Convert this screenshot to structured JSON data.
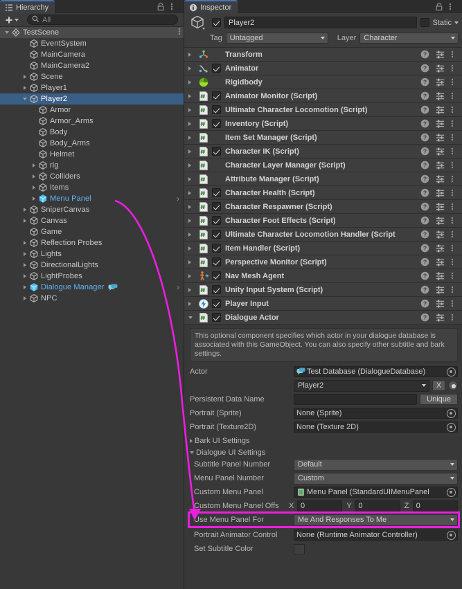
{
  "hierarchy": {
    "tab_label": "Hierarchy",
    "tab_icon": "hierarchy-icon",
    "toolbar": {
      "add_label": "+",
      "search_placeholder": "All",
      "search_value": ""
    },
    "items": [
      {
        "label": "TestScene",
        "depth": 0,
        "twisty": "down",
        "icon": "scene-icon",
        "type": "scene",
        "selected": false,
        "kebab": true
      },
      {
        "label": "EventSystem",
        "depth": 2,
        "twisty": "none",
        "icon": "gameobject-icon",
        "type": "go",
        "selected": false
      },
      {
        "label": "MainCamera",
        "depth": 2,
        "twisty": "none",
        "icon": "gameobject-icon",
        "type": "go",
        "selected": false
      },
      {
        "label": "MainCamera2",
        "depth": 2,
        "twisty": "none",
        "icon": "gameobject-icon",
        "type": "go",
        "selected": false
      },
      {
        "label": "Scene",
        "depth": 2,
        "twisty": "right",
        "icon": "gameobject-icon",
        "type": "go",
        "selected": false
      },
      {
        "label": "Player1",
        "depth": 2,
        "twisty": "right",
        "icon": "gameobject-icon",
        "type": "go",
        "selected": false
      },
      {
        "label": "Player2",
        "depth": 2,
        "twisty": "down",
        "icon": "gameobject-icon",
        "type": "go",
        "selected": true
      },
      {
        "label": "Armor",
        "depth": 3,
        "twisty": "none",
        "icon": "gameobject-icon",
        "type": "go",
        "selected": false
      },
      {
        "label": "Armor_Arms",
        "depth": 3,
        "twisty": "none",
        "icon": "gameobject-icon",
        "type": "go",
        "selected": false
      },
      {
        "label": "Body",
        "depth": 3,
        "twisty": "none",
        "icon": "gameobject-icon",
        "type": "go",
        "selected": false
      },
      {
        "label": "Body_Arms",
        "depth": 3,
        "twisty": "none",
        "icon": "gameobject-icon",
        "type": "go",
        "selected": false
      },
      {
        "label": "Helmet",
        "depth": 3,
        "twisty": "none",
        "icon": "gameobject-icon",
        "type": "go",
        "selected": false
      },
      {
        "label": "rig",
        "depth": 3,
        "twisty": "right",
        "icon": "gameobject-icon",
        "type": "go",
        "selected": false
      },
      {
        "label": "Colliders",
        "depth": 3,
        "twisty": "right",
        "icon": "gameobject-icon",
        "type": "go",
        "selected": false
      },
      {
        "label": "Items",
        "depth": 3,
        "twisty": "right",
        "icon": "gameobject-icon",
        "type": "go",
        "selected": false
      },
      {
        "label": "Menu Panel",
        "depth": 3,
        "twisty": "right",
        "icon": "prefab-icon",
        "type": "prefab",
        "selected": false,
        "chevron": true
      },
      {
        "label": "SniperCanvas",
        "depth": 2,
        "twisty": "right",
        "icon": "gameobject-icon",
        "type": "go",
        "selected": false
      },
      {
        "label": "Canvas",
        "depth": 2,
        "twisty": "right",
        "icon": "gameobject-icon",
        "type": "go",
        "selected": false
      },
      {
        "label": "Game",
        "depth": 2,
        "twisty": "none",
        "icon": "gameobject-icon",
        "type": "go",
        "selected": false
      },
      {
        "label": "Reflection Probes",
        "depth": 2,
        "twisty": "right",
        "icon": "gameobject-icon",
        "type": "go",
        "selected": false
      },
      {
        "label": "Lights",
        "depth": 2,
        "twisty": "right",
        "icon": "gameobject-icon",
        "type": "go",
        "selected": false
      },
      {
        "label": "DirectionalLights",
        "depth": 2,
        "twisty": "right",
        "icon": "gameobject-icon",
        "type": "go",
        "selected": false
      },
      {
        "label": "LightProbes",
        "depth": 2,
        "twisty": "right",
        "icon": "gameobject-icon",
        "type": "go",
        "selected": false
      },
      {
        "label": "Dialogue Manager",
        "depth": 2,
        "twisty": "right",
        "icon": "prefab-icon",
        "type": "prefab",
        "selected": false,
        "chevron": true,
        "badge": "dialogue-badge-icon"
      },
      {
        "label": "NPC",
        "depth": 2,
        "twisty": "right",
        "icon": "gameobject-icon",
        "type": "go",
        "selected": false
      }
    ]
  },
  "inspector": {
    "tab_label": "Inspector",
    "tab_icon": "info-icon",
    "header": {
      "enabled": true,
      "object_name": "Player2",
      "static_label": "Static",
      "static_checked": false,
      "tag_label": "Tag",
      "tag_value": "Untagged",
      "layer_label": "Layer",
      "layer_value": "Character"
    },
    "components": [
      {
        "name": "Transform",
        "icon": "transform-icon",
        "has_toggle": false,
        "checked": false,
        "expanded": false
      },
      {
        "name": "Animator",
        "icon": "animator-icon",
        "has_toggle": true,
        "checked": true,
        "expanded": false
      },
      {
        "name": "Rigidbody",
        "icon": "rigidbody-icon",
        "has_toggle": false,
        "checked": false,
        "expanded": false
      },
      {
        "name": "Animator Monitor (Script)",
        "icon": "script-icon",
        "has_toggle": true,
        "checked": true,
        "expanded": false
      },
      {
        "name": "Ultimate Character Locomotion (Script)",
        "icon": "script-icon",
        "has_toggle": true,
        "checked": true,
        "expanded": false
      },
      {
        "name": "Inventory (Script)",
        "icon": "script-icon",
        "has_toggle": true,
        "checked": true,
        "expanded": false
      },
      {
        "name": "Item Set Manager (Script)",
        "icon": "script-icon",
        "has_toggle": false,
        "checked": false,
        "expanded": false
      },
      {
        "name": "Character IK (Script)",
        "icon": "script-icon",
        "has_toggle": true,
        "checked": true,
        "expanded": false
      },
      {
        "name": "Character Layer Manager (Script)",
        "icon": "script-icon",
        "has_toggle": false,
        "checked": false,
        "expanded": false
      },
      {
        "name": "Attribute Manager (Script)",
        "icon": "script-icon",
        "has_toggle": false,
        "checked": false,
        "expanded": false
      },
      {
        "name": "Character Health (Script)",
        "icon": "script-icon",
        "has_toggle": true,
        "checked": true,
        "expanded": false
      },
      {
        "name": "Character Respawner (Script)",
        "icon": "script-icon",
        "has_toggle": true,
        "checked": true,
        "expanded": false
      },
      {
        "name": "Character Foot Effects (Script)",
        "icon": "script-icon",
        "has_toggle": true,
        "checked": true,
        "expanded": false
      },
      {
        "name": "Ultimate Character Locomotion Handler (Script",
        "icon": "script-icon",
        "has_toggle": true,
        "checked": true,
        "expanded": false
      },
      {
        "name": "Item Handler (Script)",
        "icon": "script-icon",
        "has_toggle": true,
        "checked": true,
        "expanded": false
      },
      {
        "name": "Perspective Monitor (Script)",
        "icon": "script-icon",
        "has_toggle": true,
        "checked": true,
        "expanded": false
      },
      {
        "name": "Nav Mesh Agent",
        "icon": "navmeshagent-icon",
        "has_toggle": true,
        "checked": true,
        "expanded": false
      },
      {
        "name": "Unity Input System (Script)",
        "icon": "script-icon",
        "has_toggle": true,
        "checked": true,
        "expanded": false
      },
      {
        "name": "Player Input",
        "icon": "playerinput-icon",
        "has_toggle": true,
        "checked": true,
        "expanded": false
      },
      {
        "name": "Dialogue Actor",
        "icon": "script-icon",
        "has_toggle": true,
        "checked": true,
        "expanded": true
      }
    ],
    "component_row_icons": {
      "help": "help-icon",
      "preset": "preset-icon",
      "menu": "kebab-icon"
    },
    "dialogue_actor": {
      "helpbox": "This optional component specifies which actor in your dialogue database is associated with this GameObject. You can also specify other subtitle and bark settings.",
      "actor_label": "Actor",
      "actor_database_value": "Test Database (DialogueDatabase)",
      "actor_database_icon": "dialogue-db-icon",
      "actor_dropdown_value": "Player2",
      "actor_clear_label": "X",
      "persistent_label": "Persistent Data Name",
      "persistent_value": "",
      "unique_button": "Unique",
      "portrait_sprite_label": "Portrait (Sprite)",
      "portrait_sprite_value": "None (Sprite)",
      "portrait_texture_label": "Portrait (Texture2D)",
      "portrait_texture_value": "None (Texture 2D)",
      "bark_ui_settings_label": "Bark UI Settings",
      "dialogue_ui_settings_label": "Dialogue UI Settings",
      "subtitle_panel_label": "Subtitle Panel Number",
      "subtitle_panel_value": "Default",
      "menu_panel_label": "Menu Panel Number",
      "menu_panel_value": "Custom",
      "custom_menu_panel_label": "Custom Menu Panel",
      "custom_menu_panel_value": "Menu Panel (StandardUIMenuPanel",
      "custom_menu_panel_icon": "prefab-small-icon",
      "offset_label": "Custom Menu Panel Offs",
      "offset_x_axis": "X",
      "offset_x_value": "0",
      "offset_y_axis": "Y",
      "offset_y_value": "0",
      "offset_z_axis": "Z",
      "offset_z_value": "0",
      "use_menu_panel_for_label": "Use Menu Panel For",
      "use_menu_panel_for_value": "Me And Responses To Me",
      "portrait_animator_label": "Portrait Animator Control",
      "portrait_animator_value": "None (Runtime Animator Controller)",
      "set_subtitle_color_label": "Set Subtitle Color",
      "set_subtitle_color_checked": false
    }
  },
  "annotations": {
    "highlight_color": "#ec1ee0",
    "arrow_from": "Menu Panel",
    "arrow_to": "Custom Menu Panel",
    "highlight_target": "Use Menu Panel For"
  }
}
